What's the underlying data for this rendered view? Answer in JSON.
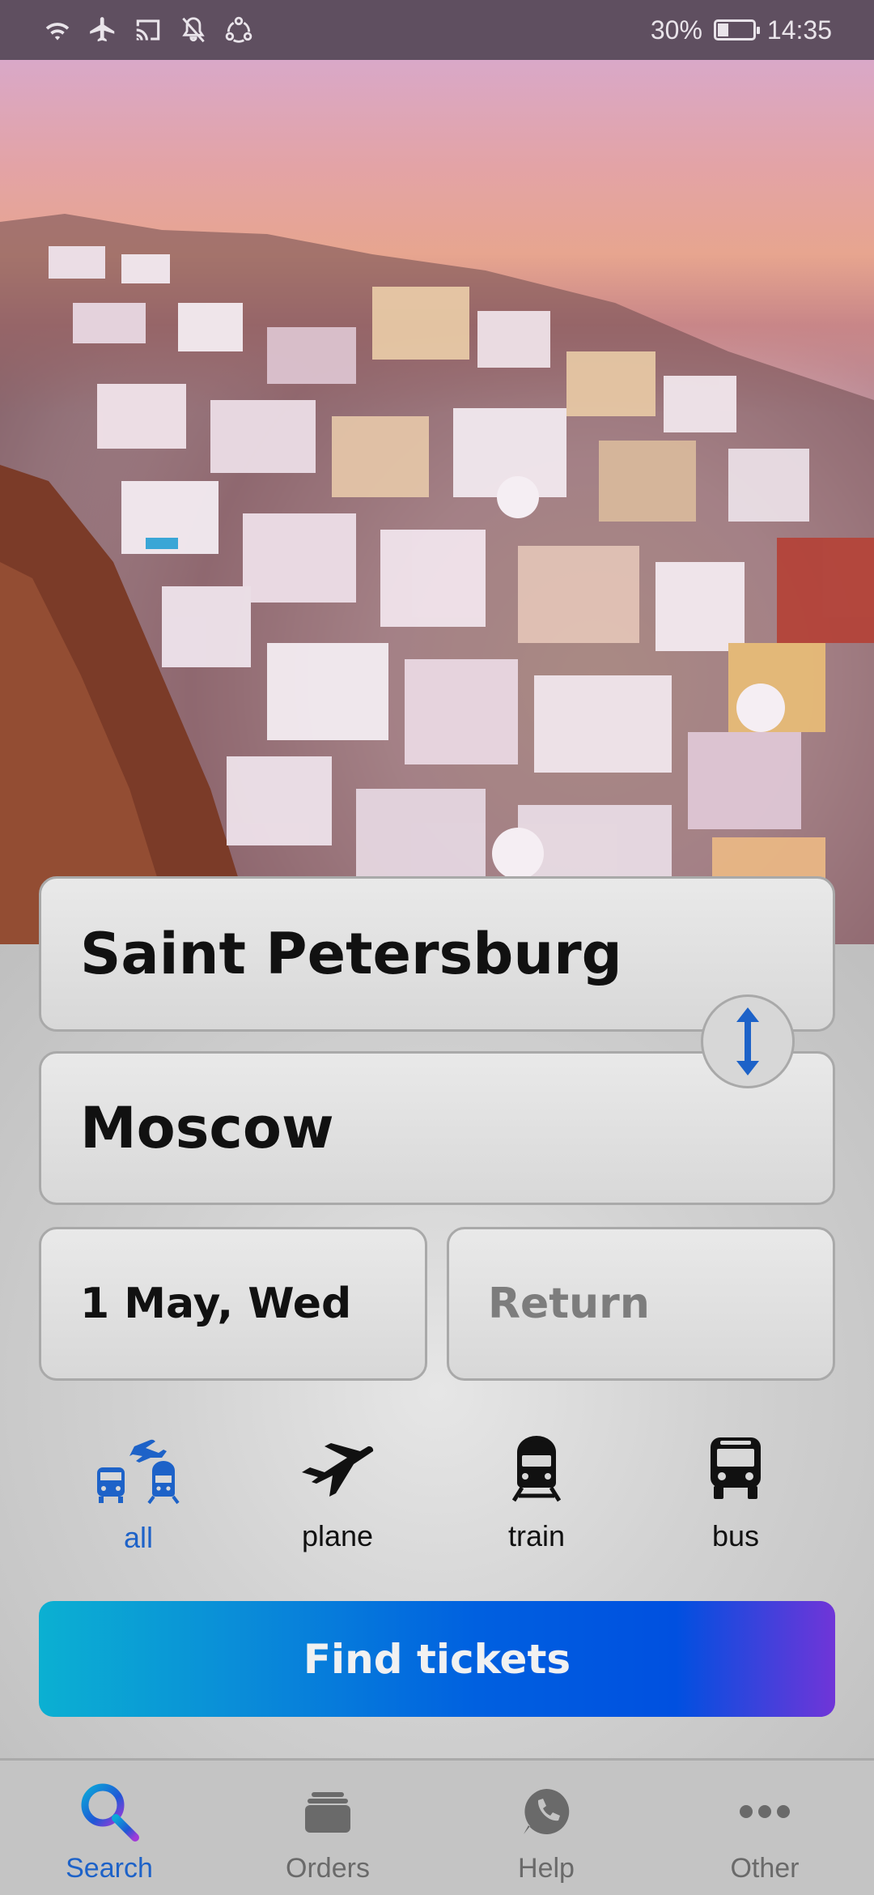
{
  "status_bar": {
    "battery": "30%",
    "battery_level": 0.3,
    "time": "14:35",
    "icons": [
      "wifi-icon",
      "airplane-mode-icon",
      "cast-icon",
      "notifications-off-icon",
      "sync-icon"
    ]
  },
  "hero": {
    "image": "santorini-village-at-sunset"
  },
  "form": {
    "from": "Saint Petersburg",
    "to": "Moscow",
    "depart_date": "1 May, Wed",
    "return_placeholder": "Return"
  },
  "transport_modes": [
    {
      "label": "all",
      "icon": "all-transport-icon",
      "active": true
    },
    {
      "label": "plane",
      "icon": "plane-icon",
      "active": false
    },
    {
      "label": "train",
      "icon": "train-icon",
      "active": false
    },
    {
      "label": "bus",
      "icon": "bus-icon",
      "active": false
    }
  ],
  "find_button": "Find tickets",
  "bottom_nav": [
    {
      "label": "Search",
      "icon": "search-icon",
      "active": true
    },
    {
      "label": "Orders",
      "icon": "orders-icon",
      "active": false
    },
    {
      "label": "Help",
      "icon": "help-icon",
      "active": false
    },
    {
      "label": "Other",
      "icon": "more-icon",
      "active": false
    }
  ],
  "colors": {
    "accent": "#1d62c8",
    "button_gradient": [
      "#0bb0d2",
      "#0060e0",
      "#7035d8"
    ],
    "status_bar": "#5f4f60"
  }
}
